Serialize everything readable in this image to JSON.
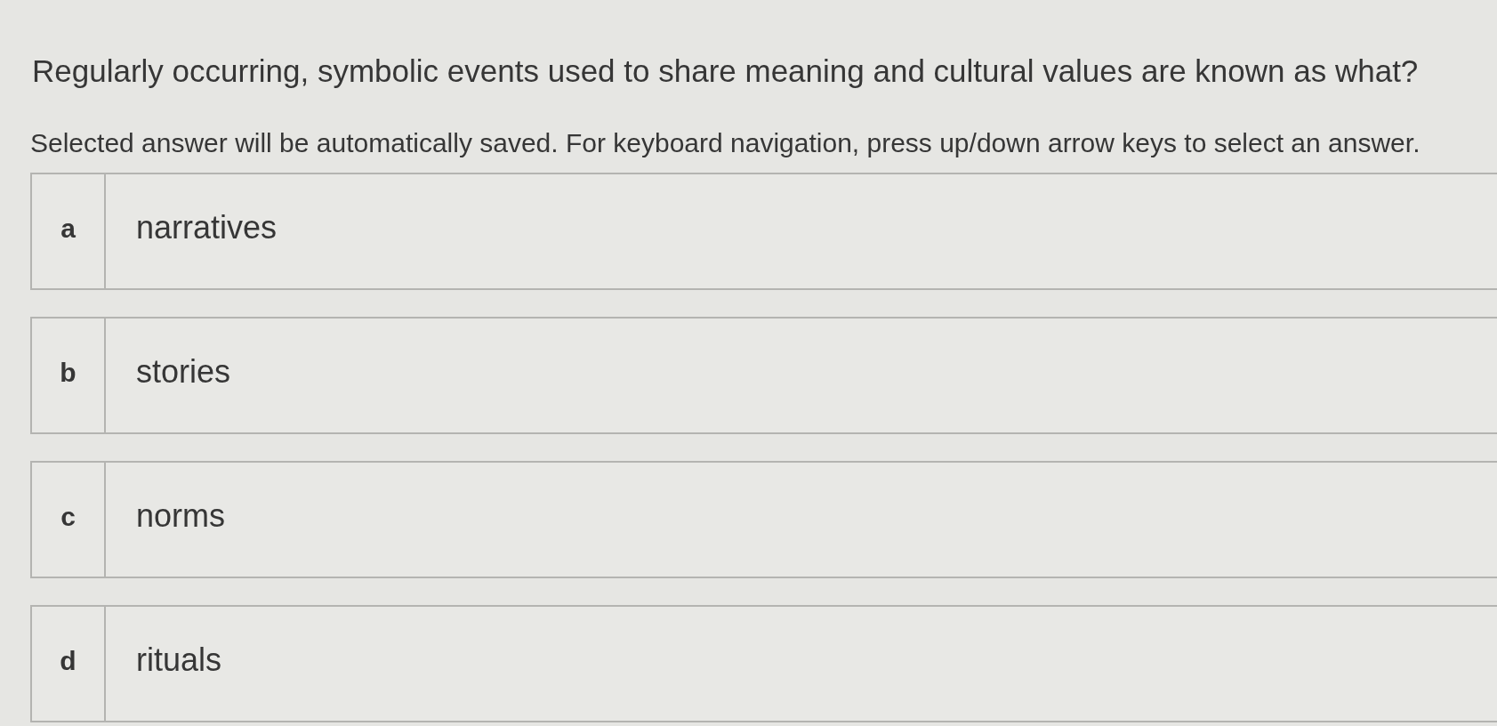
{
  "question": "Regularly occurring, symbolic events used to share meaning and cultural values are known as what?",
  "instructions": "Selected answer will be automatically saved. For keyboard navigation, press up/down arrow keys to select an answer.",
  "options": [
    {
      "letter": "a",
      "text": "narratives",
      "selected": false
    },
    {
      "letter": "b",
      "text": "stories",
      "selected": false
    },
    {
      "letter": "c",
      "text": "norms",
      "selected": false
    },
    {
      "letter": "d",
      "text": "rituals",
      "selected": false
    }
  ]
}
